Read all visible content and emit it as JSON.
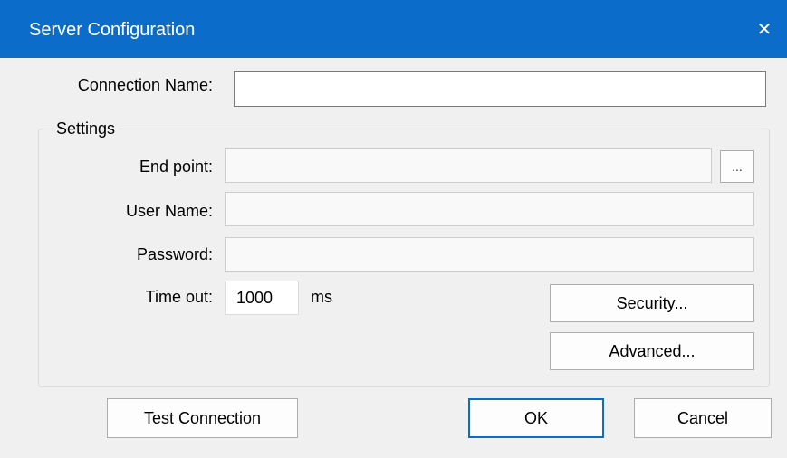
{
  "window": {
    "title": "Server Configuration",
    "close_icon": "close-icon"
  },
  "connection": {
    "label": "Connection Name:",
    "value": ""
  },
  "settings": {
    "group_label": "Settings",
    "endpoint": {
      "label": "End point:",
      "value": "",
      "browse_label": "..."
    },
    "username": {
      "label": "User Name:",
      "value": ""
    },
    "password": {
      "label": "Password:",
      "value": ""
    },
    "timeout": {
      "label": "Time out:",
      "value": "1000",
      "unit": "ms"
    },
    "security_button": "Security...",
    "advanced_button": "Advanced..."
  },
  "footer": {
    "test_button": "Test Connection",
    "ok_button": "OK",
    "cancel_button": "Cancel"
  },
  "colors": {
    "titlebar": "#0b6cc9",
    "dialog_bg": "#f0f0f0"
  }
}
